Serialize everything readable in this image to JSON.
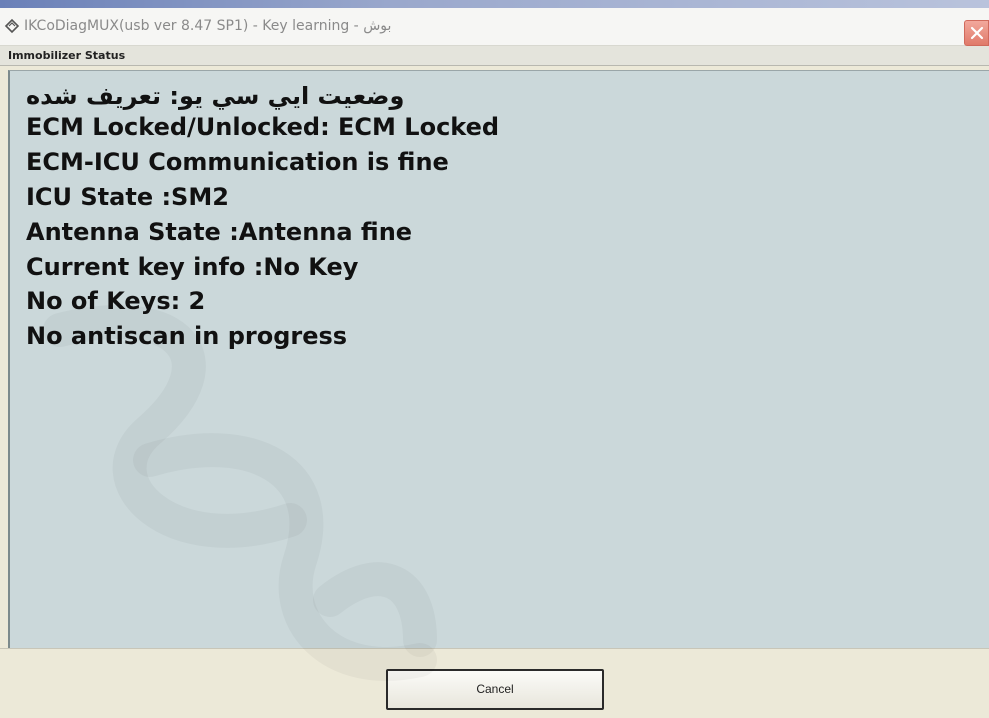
{
  "window": {
    "title": "IKCoDiagMUX(usb ver 8.47 SP1)  - Key learning - بوش",
    "close_icon": "close-icon"
  },
  "section": {
    "title": "Immobilizer Status"
  },
  "status_lines": [
    "وضعيت ايي سي يو: تعريف شده",
    "ECM Locked/Unlocked: ECM Locked",
    "ECM-ICU Communication is fine",
    "ICU State :SM2",
    "Antenna State :Antenna fine",
    "Current key info :No Key",
    "No of Keys: 2",
    "No antiscan in progress"
  ],
  "footer": {
    "cancel_label": "Cancel"
  },
  "colors": {
    "panel_background": "#cbd8da",
    "window_chrome": "#ece9d8",
    "close_button": "#e07a6a"
  }
}
